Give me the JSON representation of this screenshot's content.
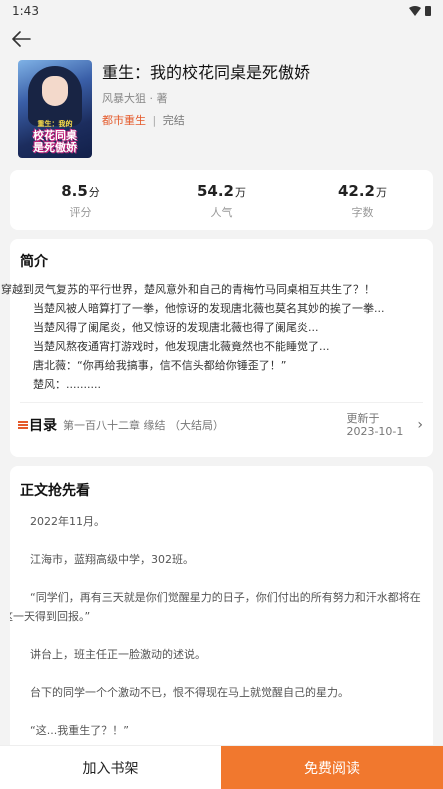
{
  "status_bar": {
    "time": "1:43"
  },
  "book": {
    "title": "重生：我的校花同桌是死傲娇",
    "author": "风暴大狙 · 著",
    "category": "都市重生",
    "separator": "|",
    "status": "完结",
    "cover_text": {
      "line1": "重生：我的",
      "line2": "校花同桌",
      "line3": "是死傲娇"
    }
  },
  "stats": [
    {
      "value": "8.5",
      "unit": "分",
      "label": "评分"
    },
    {
      "value": "54.2",
      "unit": "万",
      "label": "人气"
    },
    {
      "value": "42.2",
      "unit": "万",
      "label": "字数"
    }
  ],
  "intro": {
    "title": "简介",
    "lines": [
      "穿越到灵气复苏的平行世界，楚风意外和自己的青梅竹马同桌相互共生了？！",
      "当楚风被人暗算打了一拳，他惊讶的发现唐北薇也莫名其妙的挨了一拳...",
      "当楚风得了阑尾炎，他又惊讶的发现唐北薇也得了阑尾炎...",
      "当楚风熬夜通宵打游戏时，他发现唐北薇竟然也不能睡觉了...",
      "唐北薇：“你再给我搞事，信不信头都给你锤歪了！”",
      "楚风：.........."
    ]
  },
  "catalog": {
    "label": "目录",
    "latest_chapter": "第一百八十二章 缘结 （大结局）",
    "update_label": "更新于",
    "update_date": "2023-10-1"
  },
  "preview": {
    "title": "正文抢先看",
    "paragraphs": [
      "2022年11月。",
      "江海市，蓝翔高级中学，302班。",
      "“同学们，再有三天就是你们觉醒星力的日子，你们付出的所有努力和汗水都将在这一天得到回报。”",
      "讲台上，班主任正一脸激动的述说。",
      "台下的同学一个个激动不已，恨不得现在马上就觉醒自己的星力。",
      "“这...我重生了？！”"
    ]
  },
  "bottom_bar": {
    "add_shelf_label": "加入书架",
    "read_label": "免费阅读"
  },
  "colors": {
    "accent": "#f1782e",
    "category": "#e45a2b",
    "background": "#f3f3f3"
  }
}
